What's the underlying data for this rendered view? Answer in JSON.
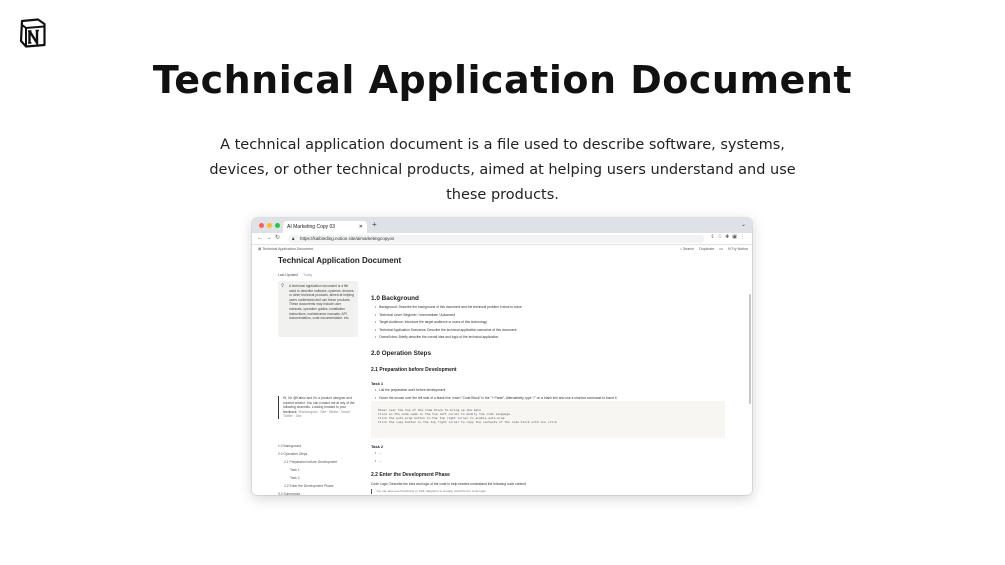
{
  "hero": {
    "title": "Technical Application Document",
    "description": "A technical application document is a file used to describe software, systems, devices, or other technical products, aimed at helping users understand and use these products."
  },
  "browser": {
    "tab_title": "AI Marketing Copy 03",
    "url": "https://kaibinding.notion.site/aimarketingcopyos"
  },
  "notion": {
    "breadcrumb": "Technical Application Document",
    "search": "Search",
    "duplicate": "Duplicate",
    "more": "•••",
    "try_notion": "Try Notion",
    "doc_title": "Technical Application Document",
    "last_updated_label": "Last Updated",
    "last_updated_value": "Today",
    "callout": "A technical application document is a file used to describe software, systems, devices, or other technical products, aimed at helping users understand and use these products. These documents may include user manuals, operation guides, installation instructions, maintenance manuals, API documentation, code documentation, etc.",
    "quote": "Hi, I'm @Kaibin and I'm a product designer and content creator. You can contact me at any of the following channels. Looking forward to your feedback:",
    "quote_links": "Xiaohongshu · Site · Weibo · Email · Twitter · Jike",
    "toc": [
      {
        "label": "1.0 Background",
        "level": 1
      },
      {
        "label": "2.0 Operation Steps",
        "level": 1
      },
      {
        "label": "2.1 Preparation before Development",
        "level": 2
      },
      {
        "label": "Task 1",
        "level": 3
      },
      {
        "label": "Task 2",
        "level": 3
      },
      {
        "label": "2.2 Enter the Development Phase",
        "level": 2
      },
      {
        "label": "3.0 Summarize",
        "level": 1
      }
    ],
    "sections": {
      "background_heading": "1.0 Background",
      "background_items": [
        "Background: Describe the background of this document and the technical problem it aims to solve",
        "Technical Level: Beginner / Intermediate / Advanced",
        "Target Audience: Introduce the target audience or users of this technology",
        "Technical Application Scenarios: Describe the technical application scenarios of this document",
        "Overall idea: Briefly describe the overall idea and logic of the technical application"
      ],
      "operation_heading": "2.0 Operation Steps",
      "prep_heading": "2.1 Preparation before Development",
      "task1_heading": "Task 1",
      "task1_items": [
        "List the preparation work before development",
        "Hover the mouse over the left side of a blank line, insert \"Code Block\" in the \"+ Panel\". Alternatively, type \"/\" on a blank line and use a shortcut command to insert it"
      ],
      "code_lines": [
        "Hover over the top of the code block to bring up the menu",
        "Click on the code name in the top left corner to modify the code language",
        "Click the auto-wrap button in the top right corner to enable auto-wrap",
        "Click the copy button in the top right corner to copy the contents of the code block with one click"
      ],
      "task2_heading": "Task 2",
      "task2_items": [
        "...",
        "..."
      ],
      "dev_heading": "2.2 Enter the Development Phase",
      "dev_text": "Code Logic: Describe the idea and logic of the code to help readers understand the following code content",
      "dev_note": "You can also use flowcharts or UML diagrams to visually describe the code logic."
    }
  },
  "colors": {
    "traffic_red": "#ff5f57",
    "traffic_yellow": "#febc2e",
    "traffic_green": "#28c840"
  }
}
